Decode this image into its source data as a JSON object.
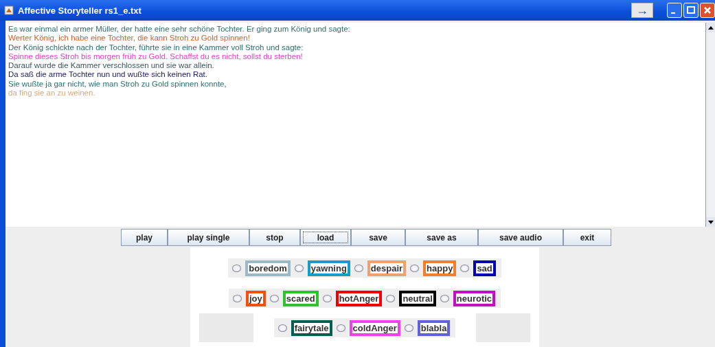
{
  "window": {
    "title": "Affective Storyteller rs1_e.txt"
  },
  "title_bar_buttons": [
    {
      "kind": "arrow",
      "label": "→"
    },
    {
      "kind": "minimize"
    },
    {
      "kind": "maximize"
    },
    {
      "kind": "close"
    }
  ],
  "story_lines": [
    {
      "text": "Es war einmal ein armer Müller, der hatte eine sehr schöne Tochter. Er ging zum König und sagte:",
      "color": "#336b6b"
    },
    {
      "text": "Werter König, ich habe eine Tochter, die kann Stroh zu Gold spinnen!",
      "color": "#d0602a"
    },
    {
      "text": "Der König schickte nach der Tochter, führte sie in eine Kammer voll Stroh und sagte:",
      "color": "#23706a"
    },
    {
      "text": "Spinne dieses Stroh bis morgen früh zu Gold. Schaffst du es nicht, sollst du sterben!",
      "color": "#e040c8"
    },
    {
      "text": "Darauf wurde die Kammer verschlossen und sie war allein.",
      "color": "#3a5858"
    },
    {
      "text": "Da saß die arme Tochter nun und wußte sich keinen Rat.",
      "color": "#202060"
    },
    {
      "text": "Sie wußte ja gar nicht, wie man Stroh zu Gold spinnen konnte,",
      "color": "#2a7070"
    },
    {
      "text": "da fing sie an zu weinen.",
      "color": "#d8a878"
    }
  ],
  "buttons": [
    {
      "label": "play",
      "focused": false
    },
    {
      "label": "play single",
      "focused": false
    },
    {
      "label": "stop",
      "focused": false
    },
    {
      "label": "load",
      "focused": true
    },
    {
      "label": "save",
      "focused": false
    },
    {
      "label": "save as",
      "focused": false
    },
    {
      "label": "save audio",
      "focused": false
    },
    {
      "label": "exit",
      "focused": false
    }
  ],
  "emotion_rows": [
    [
      {
        "label": "boredom",
        "color": "#9ab8c8",
        "selected": false
      },
      {
        "label": "yawning",
        "color": "#1a9ac8",
        "selected": false
      },
      {
        "label": "despair",
        "color": "#f0a070",
        "selected": false
      },
      {
        "label": "happy",
        "color": "#f08030",
        "selected": false
      },
      {
        "label": "sad",
        "color": "#0000b0",
        "selected": false
      }
    ],
    [
      {
        "label": "joy",
        "color": "#f05010",
        "selected": false
      },
      {
        "label": "scared",
        "color": "#30c030",
        "selected": false
      },
      {
        "label": "hotAnger",
        "color": "#f00000",
        "selected": false
      },
      {
        "label": "neutral",
        "color": "#000000",
        "selected": false
      },
      {
        "label": "neurotic",
        "color": "#c010c0",
        "selected": false
      }
    ],
    [
      {
        "label": "fairytale",
        "color": "#006050",
        "selected": false
      },
      {
        "label": "coldAnger",
        "color": "#f040f0",
        "selected": false
      },
      {
        "label": "blabla",
        "color": "#6060e0",
        "selected": false
      }
    ]
  ]
}
